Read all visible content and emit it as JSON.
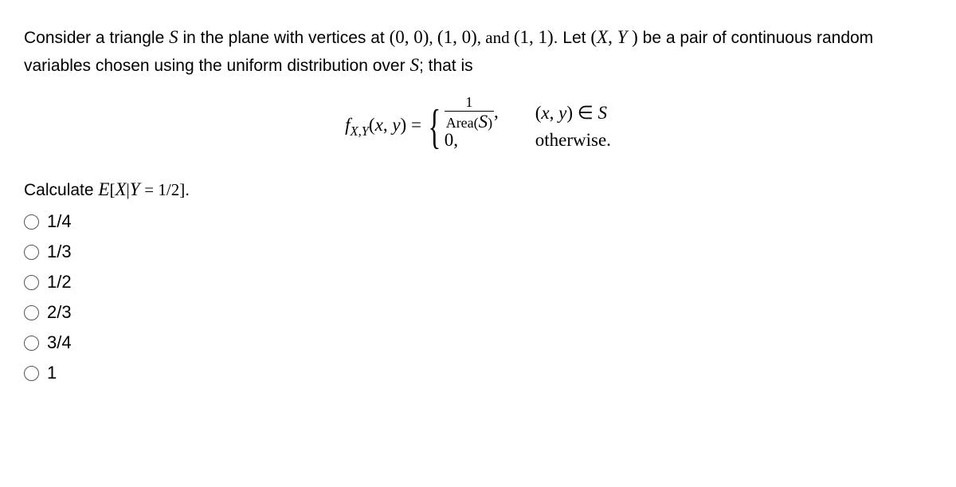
{
  "problem": {
    "line1_a": "Consider a triangle ",
    "S": "S",
    "line1_b": " in the plane with vertices at ",
    "v1": "(0, 0)",
    "v2": "(1, 0)",
    "v3": "(1, 1)",
    "line1_c": ".  Let ",
    "XY": "(X, Y )",
    "line1_d": " be a pair of continuous random variables chosen using the uniform distribution over ",
    "line1_e": "; that is"
  },
  "formula": {
    "lhs_f": "f",
    "lhs_sub": "X,Y",
    "lhs_args": "(x, y) = ",
    "frac_num": "1",
    "frac_den_a": "Area(",
    "frac_den_S": "S",
    "frac_den_b": ")",
    "comma": ",",
    "cond1_a": "(x, y) ∈ ",
    "cond1_S": "S",
    "zero": "0,",
    "cond2": "otherwise."
  },
  "question": {
    "prefix": "Calculate ",
    "E": "E",
    "inside_a": "[X|Y = 1/2]",
    "suffix": "."
  },
  "options": [
    "1/4",
    "1/3",
    "1/2",
    "2/3",
    "3/4",
    "1"
  ]
}
